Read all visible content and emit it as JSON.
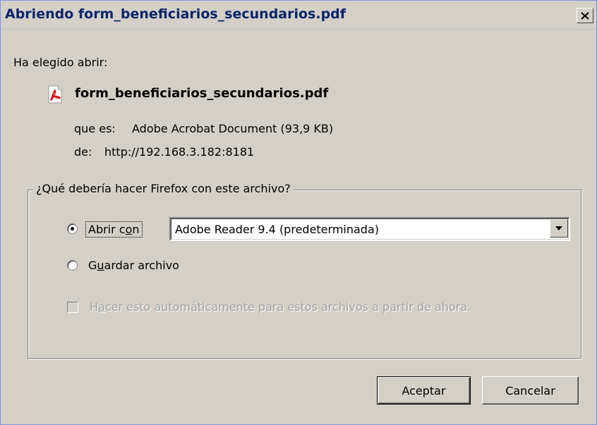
{
  "window": {
    "title": "Abriendo form_beneficiarios_secundarios.pdf",
    "close_icon": "close-icon"
  },
  "intro": "Ha elegido abrir:",
  "file": {
    "icon": "pdf-icon",
    "name": "form_beneficiarios_secundarios.pdf",
    "type_label": "que es:",
    "type_value": "Adobe Acrobat Document (93,9 KB)",
    "from_label": "de:",
    "from_value": "http://192.168.3.182:8181"
  },
  "action_group": {
    "legend": "¿Qué debería hacer Firefox con este archivo?",
    "open_with": {
      "label_pre": "Abrir c",
      "label_accel": "o",
      "label_post": "n",
      "selected": true
    },
    "app_select": {
      "value": "Adobe Reader 9.4 (predeterminada)"
    },
    "save_file": {
      "label_pre": "G",
      "label_accel": "u",
      "label_post": "ardar archivo",
      "selected": false
    },
    "auto_checkbox": {
      "label_pre": "H",
      "label_accel": "a",
      "label_post": "cer esto automáticamente para estos archivos a partir de ahora.",
      "checked": false,
      "disabled": true
    }
  },
  "buttons": {
    "ok": "Aceptar",
    "cancel": "Cancelar"
  },
  "colors": {
    "dialog_bg": "#d4d0c8",
    "title_text": "#0a246a",
    "disabled_text": "#a0a0a0"
  }
}
